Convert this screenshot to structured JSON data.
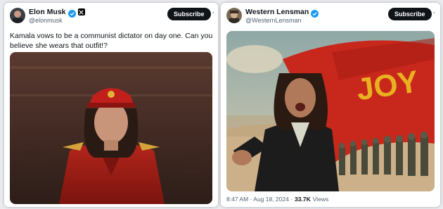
{
  "left_post": {
    "author_name": "Elon Musk",
    "author_handle": "@elonmusk",
    "subscribe_label": "Subscribe",
    "more_label": "···",
    "text": "Kamala vows to be a communist dictator on day one. Can you believe she wears that outfit!?",
    "image_alt": "woman-in-red-uniform-and-cap"
  },
  "right_post": {
    "author_name": "Western Lensman",
    "author_handle": "@WesternLensman",
    "subscribe_label": "Subscribe",
    "more_label": "···",
    "banner_text": "JOY",
    "timestamp": "8:47 AM · Aug 18, 2024 ·",
    "views_count": "33.7K",
    "views_label": "Views",
    "image_alt": "woman-pointing-with-red-banner-and-marching-soldiers"
  },
  "colors": {
    "verified": "#1d9bf0",
    "text_primary": "#0f1419",
    "text_secondary": "#536471",
    "banner_red": "#c8281c",
    "banner_text": "#e9b020"
  }
}
